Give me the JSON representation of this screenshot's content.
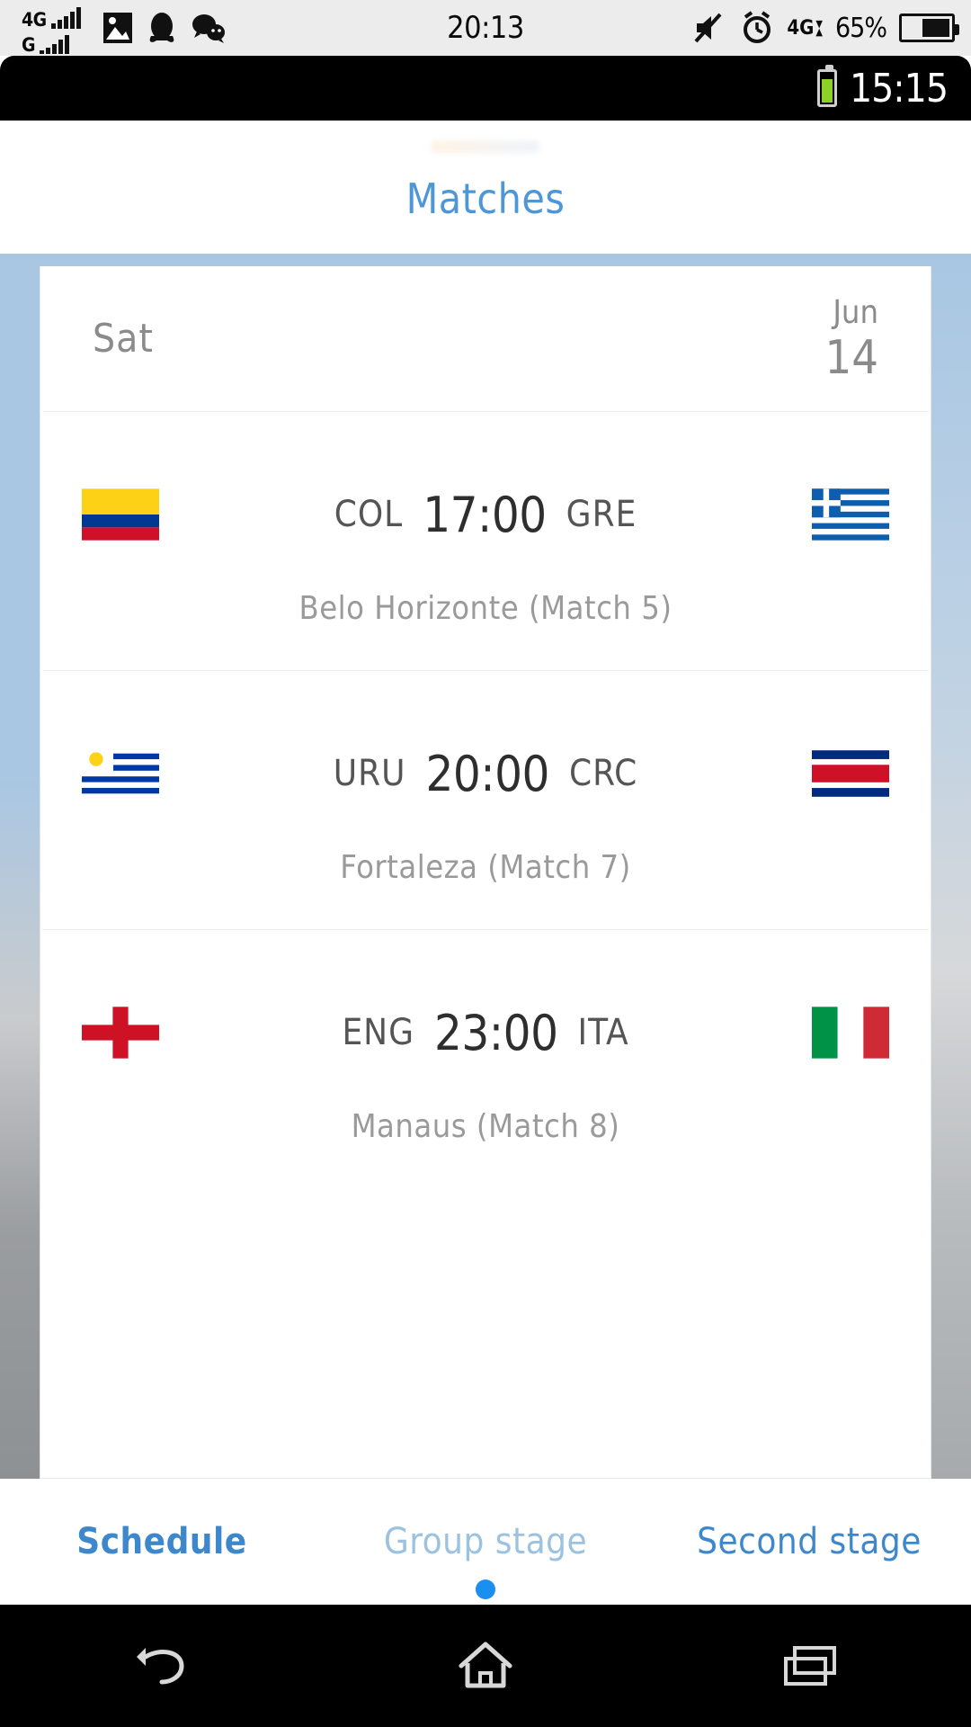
{
  "system_bar": {
    "network_primary": "4G",
    "network_secondary": "G",
    "clock": "20:13",
    "battery_percent": "65%",
    "data_indicator": "4G",
    "icons": [
      "photo-icon",
      "qq-penguin-icon",
      "wechat-icon",
      "mute-icon",
      "alarm-icon"
    ]
  },
  "device_bar": {
    "clock": "15:15",
    "battery_icon": "battery-icon"
  },
  "header": {
    "title": "Matches"
  },
  "schedule": {
    "date_header": {
      "day_of_week": "Sat",
      "month": "Jun",
      "day": "14"
    },
    "matches": [
      {
        "home_abbr": "COL",
        "home_flag": "colombia-flag",
        "time": "17:00",
        "away_abbr": "GRE",
        "away_flag": "greece-flag",
        "venue": "Belo Horizonte (Match  5)"
      },
      {
        "home_abbr": "URU",
        "home_flag": "uruguay-flag",
        "time": "20:00",
        "away_abbr": "CRC",
        "away_flag": "costa-rica-flag",
        "venue": "Fortaleza (Match  7)"
      },
      {
        "home_abbr": "ENG",
        "home_flag": "england-flag",
        "time": "23:00",
        "away_abbr": "ITA",
        "away_flag": "italy-flag",
        "venue": "Manaus (Match  8)"
      }
    ]
  },
  "tabs": [
    {
      "label": "Schedule",
      "state": "active"
    },
    {
      "label": "Group stage",
      "state": "dim"
    },
    {
      "label": "Second stage",
      "state": "blue"
    }
  ],
  "nav_bar": {
    "back": "back-icon",
    "home": "home-icon",
    "recents": "recents-icon"
  },
  "colors": {
    "accent_blue": "#3d88cd",
    "title_blue": "#4d96d8",
    "frame_blue": "#a9c7e3",
    "dot_blue": "#1b8ef2",
    "battery_green": "#8ed028"
  }
}
